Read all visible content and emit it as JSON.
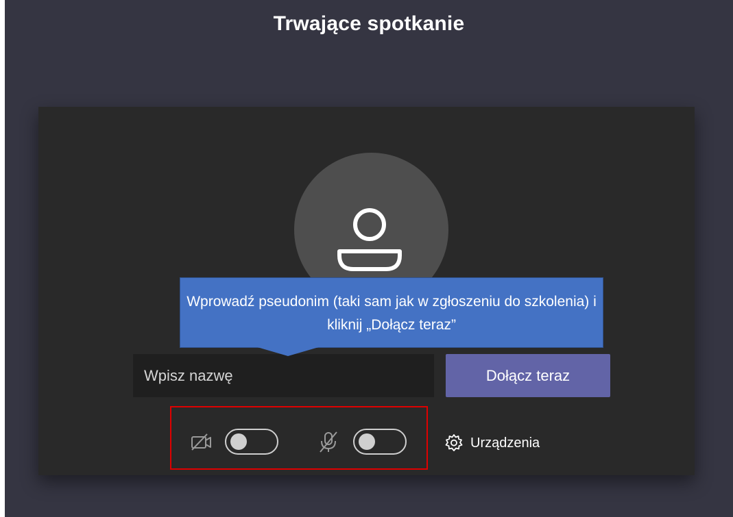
{
  "header": {
    "title": "Trwające spotkanie"
  },
  "prejoin": {
    "name_input": {
      "value": "",
      "placeholder": "Wpisz nazwę"
    },
    "join_button_label": "Dołącz teraz",
    "camera": {
      "icon": "camera-off-icon",
      "enabled": false
    },
    "microphone": {
      "icon": "mic-off-icon",
      "enabled": false
    },
    "devices": {
      "icon": "gear-icon",
      "label": "Urządzenia"
    }
  },
  "annotation": {
    "callout_text": "Wprowadź pseudonim (taki sam jak w zgłoszeniu do szkolenia) i kliknij „Dołącz teraz”",
    "highlight_color": "#e00000"
  },
  "colors": {
    "background": "#353542",
    "panel": "#292929",
    "accent": "#6264a7",
    "callout": "#4472c4"
  }
}
